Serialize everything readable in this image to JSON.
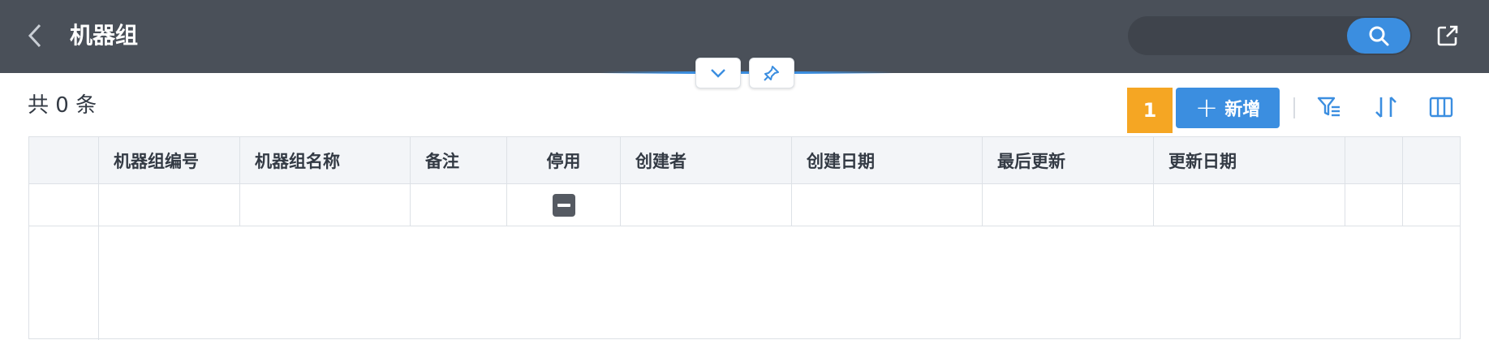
{
  "header": {
    "title": "机器组",
    "back_icon": "chevron-left-icon",
    "search": {
      "placeholder": "",
      "value": "",
      "icon": "search-icon"
    },
    "export_icon": "external-link-icon"
  },
  "panel_controls": {
    "collapse_icon": "chevron-down-icon",
    "pin_icon": "pin-icon"
  },
  "toolbar": {
    "count_label": "共 0 条",
    "badge": "1",
    "add_label": "新增",
    "add_icon": "plus-icon",
    "filter_icon": "filter-icon",
    "sort_icon": "sort-icon",
    "columns_icon": "columns-icon"
  },
  "table": {
    "columns": [
      "",
      "机器组编号",
      "机器组名称",
      "备注",
      "停用",
      "创建者",
      "创建日期",
      "最后更新",
      "更新日期",
      "",
      ""
    ],
    "filter_row": {
      "stop_toggle_icon": "minus-square-icon"
    },
    "rows": []
  },
  "colors": {
    "header_bg": "#4a5059",
    "accent": "#3b8ee0",
    "badge": "#f5a623"
  }
}
